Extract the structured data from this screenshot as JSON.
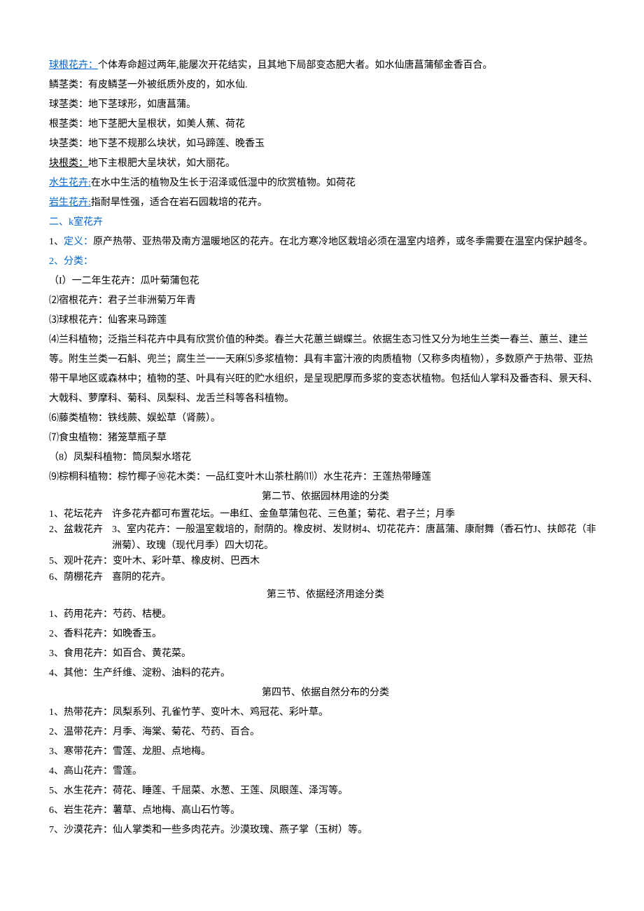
{
  "p1": {
    "a": "球根花卉：",
    "b": "个体寿命超过两年,能屡次开花结实，且其地下局部变态肥大者。如水仙唐菖蒲郁金香百合。"
  },
  "p2": "鳞茎类：有皮鳞茎一外被纸质外皮的，如水仙.",
  "p3": "球茎类：地下茎球形，如唐菖蒲。",
  "p4": "根茎类：地下茎肥大呈根状，如美人蕉、荷花",
  "p5": "块茎类：地下茎不规那么块状，如马蹄莲、晚香玉",
  "p6": {
    "a": "块根类：",
    "b": "地下主根肥大呈块状，如大丽花。"
  },
  "p7": {
    "a": "水生花卉:",
    "b": "在水中生活的植物及生长于沼泽或低湿中的欣赏植物。如荷花"
  },
  "p8": {
    "a": "岩生花卉:",
    "b": "指耐旱性强，适合在岩石园栽培的花卉。"
  },
  "p9": {
    "a": "二、",
    "b": "k室花卉"
  },
  "p10": {
    "a": "1、",
    "b": "定义：",
    "c": "原产热带、亚热带及南方温暖地区的花卉。在北方寒冷地区栽培必须在温室内培养，或冬季需要在温室内保护越冬。"
  },
  "p11": "2、分类：",
  "p12": "（I）一二年生花卉：瓜叶菊蒲包花",
  "p13": "⑵宿根花卉：君子兰非洲菊万年青",
  "p14": "⑶球根花卉：仙客来马蹄莲",
  "p15": "⑷兰科植物；泛指兰科花卉中具有欣赏价值的种类。春兰大花蕙兰蝴蝶兰。依据生态习性又分为地生兰类一春兰、蕙兰、建兰等。附生兰类一石斛、兜兰；腐生兰一一天麻⑸多浆植物：具有丰富汁液的肉质植物（又称多肉植物），多数原产于热带、亚热带干旱地区或森林中；植物的茎、叶具有兴旺的贮水组织，是呈现肥厚而多浆的变态状植物。包括仙人掌科及番杏科、景天科、大戟科、萝摩科、菊科、凤梨科、龙舌兰科等各科植物。",
  "p16": "⑹藤类植物：铁线蕨、娱蚣草（肾蕨）。",
  "p17": "⑺食虫植物：猪笼草瓶子草",
  "p18": "（8）凤梨科植物：筒凤梨水塔花",
  "p19": "⑼棕桐科植物：棕竹椰子⑩花木类：一品红变叶木山茶杜鹃⑾）水生花卉：王莲热带睡莲",
  "h2": "第二节、依据园林用途的分类",
  "s2a": {
    "a": "1、花坛花卉",
    "b": "许多花卉都可布置花坛。一串红、金鱼草蒲包花、三色堇；菊花、君子兰；月季"
  },
  "s2b": {
    "a": "2、盆栽花卉",
    "b": "3、室内花卉：一般温室栽培的，耐荫的。橡皮树、发财树4、切花花卉：唐菖蒲、康耐舞（香石竹J、扶郎花（非洲菊）、玫瑰（现代月季）四大切花。"
  },
  "s2c": "5、观叶花卉：变叶木、彩叶草、橡皮树、巴西木",
  "s2d": {
    "a": "6、荫棚花卉",
    "b": "喜阴的花卉。"
  },
  "h3": "第三节、依据经济用途分类",
  "s3a": "1、药用花卉：芍药、桔梗。",
  "s3b": "2、香料花卉：如晚香玉。",
  "s3c": "3、食用花卉：如百合、黄花菜。",
  "s3d": "4、其他：生产纤维、淀粉、油料的花卉。",
  "h4": "第四节、依据自然分布的分类",
  "s4a": "1、热带花卉：凤梨系列、孔雀竹芋、变叶木、鸡冠花、彩叶草。",
  "s4b": "2、温带花卉：月季、海棠、菊花、芍药、百合。",
  "s4c": "3、寒带花卉：雪莲、龙胆、点地梅。",
  "s4d": "4、高山花卉：雪莲。",
  "s4e": "5、水生花卉：荷花、睡莲、千屈菜、水葱、王莲、凤眼莲、泽泻等。",
  "s4f": "6、岩生花卉：薯草、点地梅、高山石竹等。",
  "s4g": "7、沙漠花卉：仙人掌类和一些多肉花卉。沙漠玫瑰、燕子掌（玉树）等。"
}
